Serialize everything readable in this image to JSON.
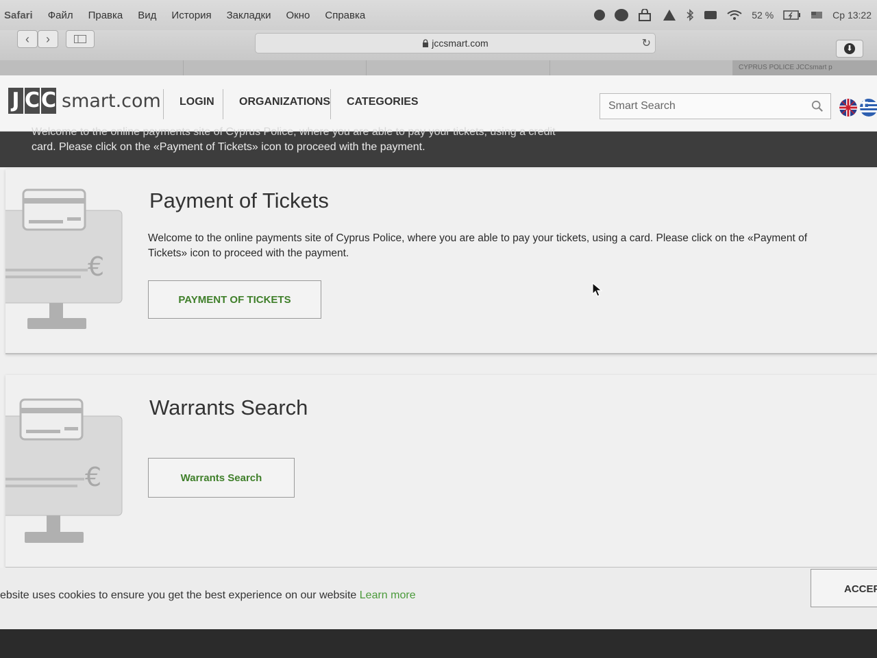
{
  "menubar": {
    "app": "Safari",
    "items": [
      "Файл",
      "Правка",
      "Вид",
      "История",
      "Закладки",
      "Окно",
      "Справка"
    ],
    "battery": "52 %",
    "clock": "Ср 13:22"
  },
  "browser": {
    "url": "jccsmart.com",
    "tabs": [
      "",
      "",
      "",
      "",
      "CYPRUS POLICE JCCsmart p"
    ]
  },
  "header": {
    "logo_letters": [
      "J",
      "C",
      "C"
    ],
    "logo_suffix": "smart.com",
    "nav": [
      "LOGIN",
      "ORGANIZATIONS",
      "CATEGORIES"
    ],
    "search_placeholder": "Smart Search"
  },
  "hero": {
    "line1": "Welcome to the online payments site of Cyprus Police, where you are able to pay your tickets, using a credit",
    "line2": "card. Please click on the «Payment of Tickets» icon to proceed with the payment."
  },
  "cards": [
    {
      "title": "Payment of Tickets",
      "description": "Welcome to the online payments site of Cyprus Police, where you are able to pay your tickets, using a card. Please click on the «Payment of Tickets» icon to proceed with the payment.",
      "button": "PAYMENT OF TICKETS",
      "currency_symbol": "€"
    },
    {
      "title": "Warrants Search",
      "button": "Warrants Search",
      "currency_symbol": "€"
    }
  ],
  "cookie": {
    "text": "ebsite uses cookies to ensure you get the best experience on our website",
    "link": "Learn more",
    "accept": "ACCEP"
  },
  "colors": {
    "accent_green": "#3f7f2a",
    "hero_bg": "#3d3d3d"
  }
}
